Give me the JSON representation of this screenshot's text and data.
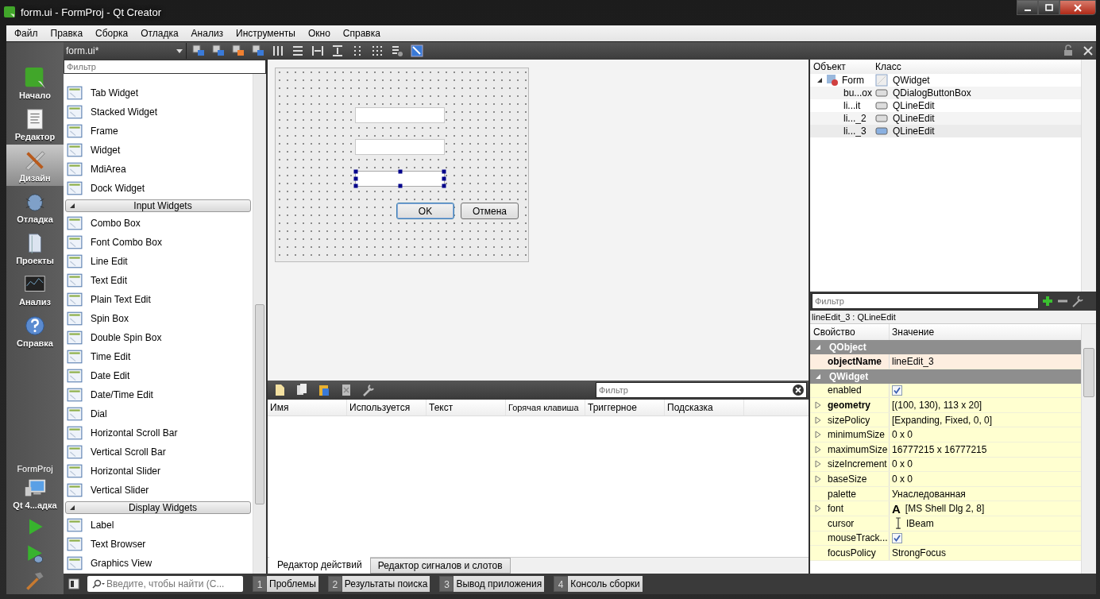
{
  "window": {
    "title": "form.ui - FormProj - Qt Creator"
  },
  "menu": [
    "Файл",
    "Правка",
    "Сборка",
    "Отладка",
    "Анализ",
    "Инструменты",
    "Окно",
    "Справка"
  ],
  "editor_toolbar": {
    "document": "form.ui*"
  },
  "mode_bar": {
    "modes": [
      {
        "label": "Начало",
        "selected": false
      },
      {
        "label": "Редактор",
        "selected": false
      },
      {
        "label": "Дизайн",
        "selected": true
      },
      {
        "label": "Отладка",
        "selected": false
      },
      {
        "label": "Проекты",
        "selected": false
      },
      {
        "label": "Анализ",
        "selected": false
      },
      {
        "label": "Справка",
        "selected": false
      }
    ],
    "project": "FormProj",
    "kit": "Qt 4...адка"
  },
  "widget_box": {
    "filter_placeholder": "Фильтр",
    "entries": [
      {
        "kind": "widget",
        "label": "Tab Widget"
      },
      {
        "kind": "widget",
        "label": "Stacked Widget"
      },
      {
        "kind": "widget",
        "label": "Frame"
      },
      {
        "kind": "widget",
        "label": "Widget"
      },
      {
        "kind": "widget",
        "label": "MdiArea"
      },
      {
        "kind": "widget",
        "label": "Dock Widget"
      },
      {
        "kind": "category",
        "label": "Input Widgets",
        "expanded": true
      },
      {
        "kind": "widget",
        "label": "Combo Box"
      },
      {
        "kind": "widget",
        "label": "Font Combo Box"
      },
      {
        "kind": "widget",
        "label": "Line Edit"
      },
      {
        "kind": "widget",
        "label": "Text Edit"
      },
      {
        "kind": "widget",
        "label": "Plain Text Edit"
      },
      {
        "kind": "widget",
        "label": "Spin Box"
      },
      {
        "kind": "widget",
        "label": "Double Spin Box"
      },
      {
        "kind": "widget",
        "label": "Time Edit"
      },
      {
        "kind": "widget",
        "label": "Date Edit"
      },
      {
        "kind": "widget",
        "label": "Date/Time Edit"
      },
      {
        "kind": "widget",
        "label": "Dial"
      },
      {
        "kind": "widget",
        "label": "Horizontal Scroll Bar"
      },
      {
        "kind": "widget",
        "label": "Vertical Scroll Bar"
      },
      {
        "kind": "widget",
        "label": "Horizontal Slider"
      },
      {
        "kind": "widget",
        "label": "Vertical Slider"
      },
      {
        "kind": "category",
        "label": "Display Widgets",
        "expanded": true
      },
      {
        "kind": "widget",
        "label": "Label"
      },
      {
        "kind": "widget",
        "label": "Text Browser"
      },
      {
        "kind": "widget",
        "label": "Graphics View"
      }
    ]
  },
  "form": {
    "fields": [
      {
        "selected": false
      },
      {
        "selected": false
      },
      {
        "selected": true
      }
    ],
    "buttons": [
      {
        "label": "OK",
        "default": true
      },
      {
        "label": "Отмена",
        "default": false
      }
    ]
  },
  "action_editor": {
    "filter_placeholder": "Фильтр",
    "columns": [
      "Имя",
      "Используется",
      "Текст",
      "Горячая клавиша",
      "Триггерное",
      "Подсказка"
    ],
    "tabs": [
      {
        "label": "Редактор действий",
        "selected": true
      },
      {
        "label": "Редактор сигналов и слотов",
        "selected": false
      }
    ]
  },
  "object_inspector": {
    "columns": [
      "Объект",
      "Класс"
    ],
    "tree": [
      {
        "object": "Form",
        "class": "QWidget",
        "expanded": true,
        "selected": false,
        "children": [
          {
            "object": "bu...ox",
            "class": "QDialogButtonBox",
            "selected": false
          },
          {
            "object": "li...it",
            "class": "QLineEdit",
            "selected": false
          },
          {
            "object": "li..._2",
            "class": "QLineEdit",
            "selected": false
          },
          {
            "object": "li..._3",
            "class": "QLineEdit",
            "selected": true
          }
        ]
      }
    ]
  },
  "property_editor": {
    "filter_placeholder": "Фильтр",
    "object_label": "lineEdit_3 : QLineEdit",
    "columns": [
      "Свойство",
      "Значение"
    ],
    "groups": [
      {
        "name": "QObject",
        "expanded": true,
        "color": "#fdeee0",
        "properties": [
          {
            "kind": "text",
            "name": "objectName",
            "value": "lineEdit_3",
            "modified": true,
            "expandable": false
          }
        ]
      },
      {
        "name": "QWidget",
        "expanded": true,
        "color": "#ffffd0",
        "properties": [
          {
            "kind": "checkbox",
            "name": "enabled",
            "checked": true,
            "modified": false,
            "expandable": false
          },
          {
            "kind": "text",
            "name": "geometry",
            "value": "[(100, 130), 113 x 20]",
            "modified": true,
            "expandable": true
          },
          {
            "kind": "text",
            "name": "sizePolicy",
            "value": "[Expanding, Fixed, 0, 0]",
            "modified": false,
            "expandable": true
          },
          {
            "kind": "text",
            "name": "minimumSize",
            "value": "0 x 0",
            "modified": false,
            "expandable": true
          },
          {
            "kind": "text",
            "name": "maximumSize",
            "value": "16777215 x 16777215",
            "modified": false,
            "expandable": true
          },
          {
            "kind": "text",
            "name": "sizeIncrement",
            "value": "0 x 0",
            "modified": false,
            "expandable": true
          },
          {
            "kind": "text",
            "name": "baseSize",
            "value": "0 x 0",
            "modified": false,
            "expandable": true
          },
          {
            "kind": "text",
            "name": "palette",
            "value": "Унаследованная",
            "modified": false,
            "expandable": false
          },
          {
            "kind": "font",
            "name": "font",
            "sample": "A",
            "value": "[MS Shell Dlg 2, 8]",
            "modified": false,
            "expandable": true
          },
          {
            "kind": "cursor",
            "name": "cursor",
            "value": "IBeam",
            "modified": false,
            "expandable": false
          },
          {
            "kind": "checkbox",
            "name": "mouseTrack...",
            "checked": true,
            "modified": false,
            "expandable": false
          },
          {
            "kind": "text",
            "name": "focusPolicy",
            "value": "StrongFocus",
            "modified": false,
            "expandable": false
          }
        ]
      }
    ]
  },
  "output_bar": {
    "search_placeholder": "Введите, чтобы найти (С...",
    "panes": [
      {
        "number": "1",
        "label": "Проблемы"
      },
      {
        "number": "2",
        "label": "Результаты поиска"
      },
      {
        "number": "3",
        "label": "Вывод приложения"
      },
      {
        "number": "4",
        "label": "Консоль сборки"
      }
    ]
  }
}
